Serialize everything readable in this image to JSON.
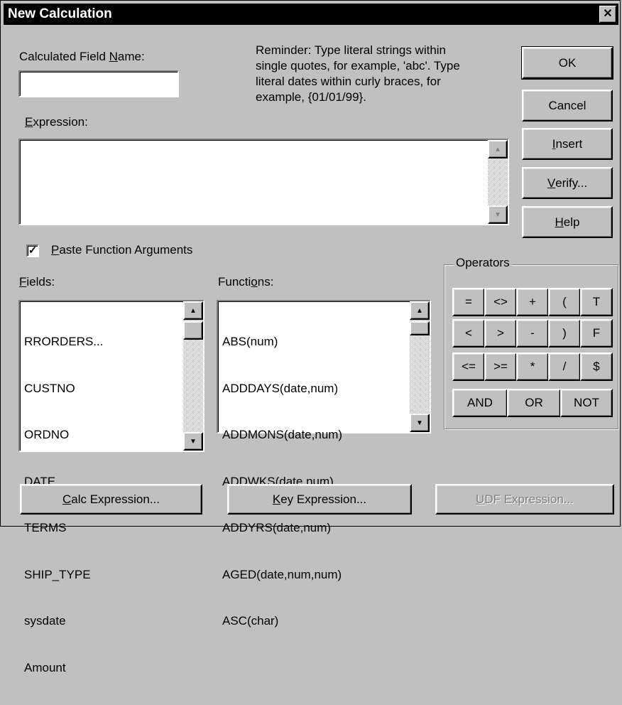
{
  "window": {
    "title": "New Calculation",
    "close_glyph": "✕"
  },
  "name_field": {
    "label_pre": "Calculated Field ",
    "label_u": "N",
    "label_post": "ame:",
    "value": ""
  },
  "reminder": {
    "line1": "Reminder: Type literal strings within",
    "line2": "single quotes, for example, 'abc'. Type",
    "line3": "literal dates within curly braces, for",
    "line4": "example, {01/01/99}."
  },
  "expression": {
    "label_u": "E",
    "label_post": "xpression:",
    "value": ""
  },
  "buttons": {
    "ok": "OK",
    "cancel": "Cancel",
    "insert_u": "I",
    "insert_post": "nsert",
    "verify_u": "V",
    "verify_post": "erify...",
    "help_u": "H",
    "help_post": "elp"
  },
  "paste_args": {
    "checked": true,
    "check_glyph": "✓",
    "label_u": "P",
    "label_post": "aste Function Arguments"
  },
  "fields": {
    "label_u": "F",
    "label_post": "ields:",
    "items": [
      "RRORDERS...",
      "  CUSTNO",
      "  ORDNO",
      "  DATE",
      "  TERMS",
      "  SHIP_TYPE",
      "  sysdate",
      "  Amount"
    ]
  },
  "functions": {
    "label_pre": "Functi",
    "label_u": "o",
    "label_post": "ns:",
    "items": [
      "ABS(num)",
      "ADDDAYS(date,num)",
      "ADDMONS(date,num)",
      "ADDWKS(date,num)",
      "ADDYRS(date,num)",
      "AGED(date,num,num)",
      "ASC(char)"
    ]
  },
  "operators": {
    "title": "Operators",
    "row1": [
      "=",
      "<>",
      "+",
      "(",
      "T"
    ],
    "row2": [
      "<",
      ">",
      "-",
      ")",
      "F"
    ],
    "row3": [
      "<=",
      ">=",
      "*",
      "/",
      "$"
    ],
    "row4": [
      "AND",
      "OR",
      "NOT"
    ]
  },
  "bottom": {
    "calc_u": "C",
    "calc_post": "alc Expression...",
    "key_u": "K",
    "key_post": "ey Expression...",
    "udf_u": "U",
    "udf_post": "DF Expression..."
  },
  "scroll_glyphs": {
    "up": "▲",
    "down": "▼"
  }
}
